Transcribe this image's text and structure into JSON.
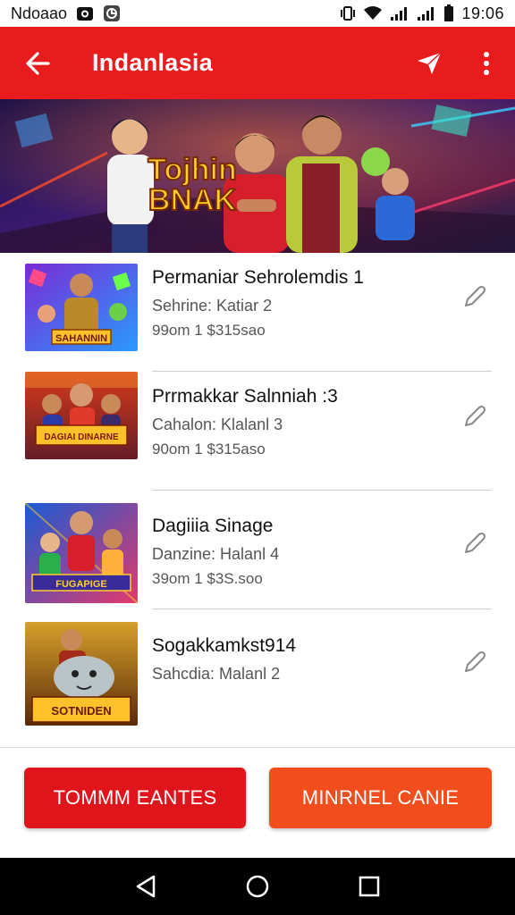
{
  "status_bar": {
    "carrier": "Ndoaao",
    "time": "19:06",
    "icons": [
      "camera-notification-icon",
      "app-notification-icon",
      "vibrate-icon",
      "wifi-icon",
      "signal-icon",
      "signal-icon",
      "battery-icon"
    ]
  },
  "app_bar": {
    "title": "Indanlasia",
    "background": "#e81c1c",
    "icons": [
      "back-arrow-icon",
      "send-icon",
      "more-vert-icon"
    ]
  },
  "banner": {
    "title_line1": "Tojhin",
    "title_line2": "BNAK"
  },
  "games": [
    {
      "title": "Permaniar Sehrolemdis 1",
      "subtitle": "Sehrine: Katiar 2",
      "price": "99om 1 $315sao",
      "thumb_text": "SAHANNIN",
      "thumb_palette": "purple"
    },
    {
      "title": "Prrmakkar Salnniah :3",
      "subtitle": "Cahalon: Klalanl 3",
      "price": "90om 1 $315aso",
      "thumb_text": "DAGIAI DINARNE",
      "thumb_palette": "orange"
    },
    {
      "title": "Dagiiia Sinage",
      "subtitle": "Danzine: Halanl 4",
      "price": "39om 1 $3S.soo",
      "thumb_text": "FUGAPIGE",
      "thumb_palette": "blue"
    },
    {
      "title": "Sogakkamkst914",
      "subtitle": "Sahcdia: Malanl 2",
      "price": "",
      "thumb_text": "SOTNIDEN",
      "thumb_palette": "gold"
    }
  ],
  "buttons": {
    "primary_label": "TOMMM EANTES",
    "secondary_label": "MINRNEL CANIE",
    "primary_color": "#e0141b",
    "secondary_color": "#f24d1c"
  },
  "nav_bar": {
    "icons": [
      "back-triangle-icon",
      "home-circle-icon",
      "recents-square-icon"
    ]
  }
}
